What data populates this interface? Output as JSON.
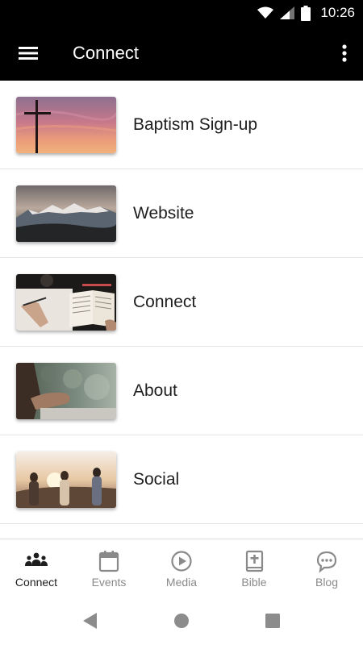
{
  "status_bar": {
    "time": "10:26",
    "icons": [
      "wifi-icon",
      "signal-icon",
      "battery-icon"
    ]
  },
  "app_bar": {
    "title": "Connect",
    "left_icon": "hamburger-menu-icon",
    "right_icon": "more-vert-icon"
  },
  "list": {
    "items": [
      {
        "label": "Baptism Sign-up",
        "thumbnail": "sunset-cross-photo"
      },
      {
        "label": "Website",
        "thumbnail": "mountain-range-photo"
      },
      {
        "label": "Connect",
        "thumbnail": "open-bible-writing-photo"
      },
      {
        "label": "About",
        "thumbnail": "praying-hands-photo"
      },
      {
        "label": "Social",
        "thumbnail": "friends-hillside-photo"
      }
    ]
  },
  "bottom_nav": {
    "tabs": [
      {
        "label": "Connect",
        "icon": "people-group-icon",
        "active": true
      },
      {
        "label": "Events",
        "icon": "calendar-icon",
        "active": false
      },
      {
        "label": "Media",
        "icon": "play-circle-icon",
        "active": false
      },
      {
        "label": "Bible",
        "icon": "bible-cross-icon",
        "active": false
      },
      {
        "label": "Blog",
        "icon": "chat-bubble-icon",
        "active": false
      }
    ]
  },
  "system_nav": {
    "buttons": [
      "back-icon",
      "home-icon",
      "recents-icon"
    ]
  },
  "colors": {
    "app_bar_bg": "#000000",
    "active_tab": "#1e1e1e",
    "inactive_tab": "#8a8a8a",
    "divider": "#e4e4e4"
  }
}
